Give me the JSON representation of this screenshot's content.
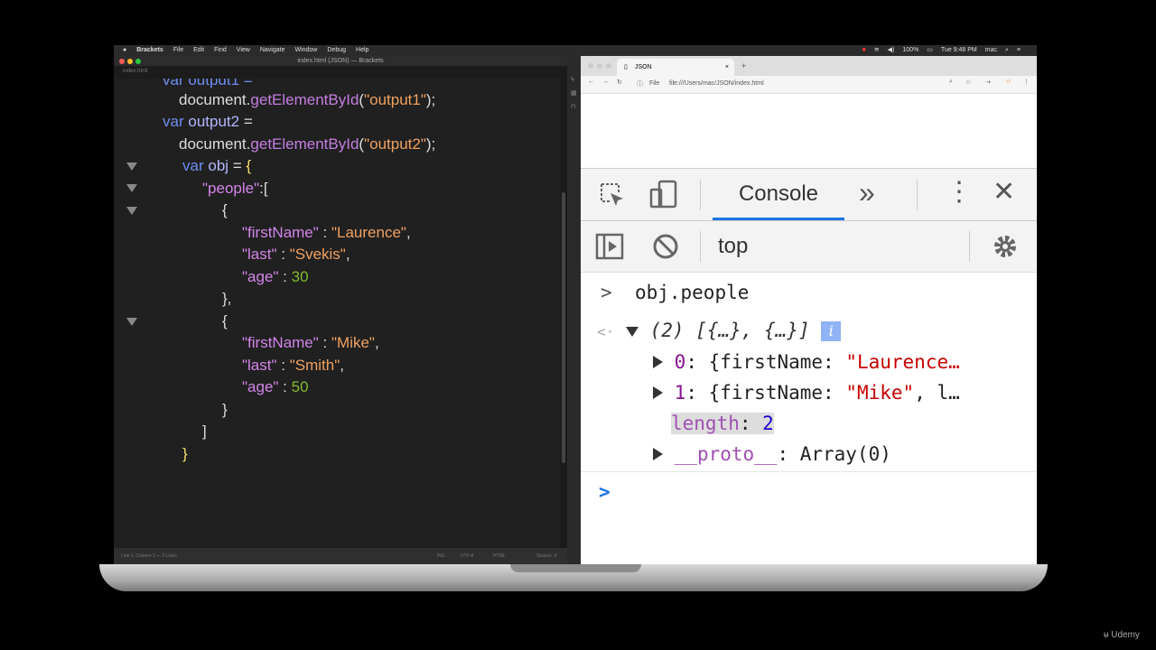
{
  "menubar": {
    "apple": "",
    "app": "Brackets",
    "items": [
      "File",
      "Edit",
      "Find",
      "View",
      "Navigate",
      "Window",
      "Debug",
      "Help"
    ],
    "status": [
      "100%",
      "Tue 9:48 PM",
      "mac"
    ]
  },
  "editor": {
    "window_title": "index.html (JSON) — Brackets",
    "tab_label": "index.html",
    "code": {
      "l0": {
        "text": "var output1 ="
      },
      "l1": {
        "obj": "document",
        "dot": ".",
        "fn": "getElementById",
        "op": "(",
        "str": "\"output1\"",
        "cl": ");"
      },
      "l2": {
        "kw": "var",
        "name": "output2",
        "eq": "="
      },
      "l3": {
        "obj": "document",
        "dot": ".",
        "fn": "getElementById",
        "op": "(",
        "str": "\"output2\"",
        "cl": ");"
      },
      "l4": {
        "kw": "var",
        "name": "obj",
        "eq": "=",
        "br": "{"
      },
      "l5": {
        "key": "\"people\"",
        "sep": ":["
      },
      "l6": {
        "br": "{"
      },
      "l7": {
        "key": "\"firstName\"",
        "sep": " : ",
        "val": "\"Laurence\"",
        "end": ","
      },
      "l8": {
        "key": "\"last\"",
        "sep": " : ",
        "val": "\"Svekis\"",
        "end": ","
      },
      "l9": {
        "key": "\"age\"",
        "sep": " : ",
        "num": "30"
      },
      "l10": {
        "br": "},"
      },
      "l11": {
        "br": "{"
      },
      "l12": {
        "key": "\"firstName\"",
        "sep": " : ",
        "val": "\"Mike\"",
        "end": ","
      },
      "l13": {
        "key": "\"last\"",
        "sep": " : ",
        "val": "\"Smith\"",
        "end": ","
      },
      "l14": {
        "key": "\"age\"",
        "sep": " : ",
        "num": "50"
      },
      "l15": {
        "br": "}"
      },
      "l16": {
        "br": "]"
      },
      "l17": {
        "br": "}"
      }
    },
    "statusbar": {
      "cursor": "Line 1, Column 1 — 5 Lines",
      "ins": "INS",
      "encoding": "UTF-8",
      "lang": "HTML",
      "spaces": "Spaces: 4"
    }
  },
  "chrome": {
    "tab_title": "JSON",
    "tab_close": "×",
    "new_tab": "+",
    "nav": {
      "back": "←",
      "forward": "→",
      "reload": "↻",
      "info": "ⓘ",
      "scheme": "File",
      "url": "file:///Users/mac/JSON/index.html"
    }
  },
  "devtools": {
    "console_tab": "Console",
    "more_tabs": "»",
    "context": "top",
    "console": {
      "input_prompt": ">",
      "input_cmd": "obj.people",
      "result_arrow": "<·",
      "result_count": "(2)",
      "result_preview": "[{…}, {…}]",
      "info": "i",
      "item0_idx": "0",
      "item0_body": "{firstName: ",
      "item0_str": "\"Laurence…",
      "item1_idx": "1",
      "item1_body": "{firstName: ",
      "item1_str": "\"Mike\"",
      "item1_tail": ", l…",
      "length_key": "length",
      "length_sep": ": ",
      "length_val": "2",
      "proto_key": "__proto__",
      "proto_val": ": Array(0)",
      "prompt": ">"
    }
  },
  "watermark": "Udemy",
  "colors": {
    "accent": "#1a73e8",
    "editor_bg": "#202020"
  }
}
